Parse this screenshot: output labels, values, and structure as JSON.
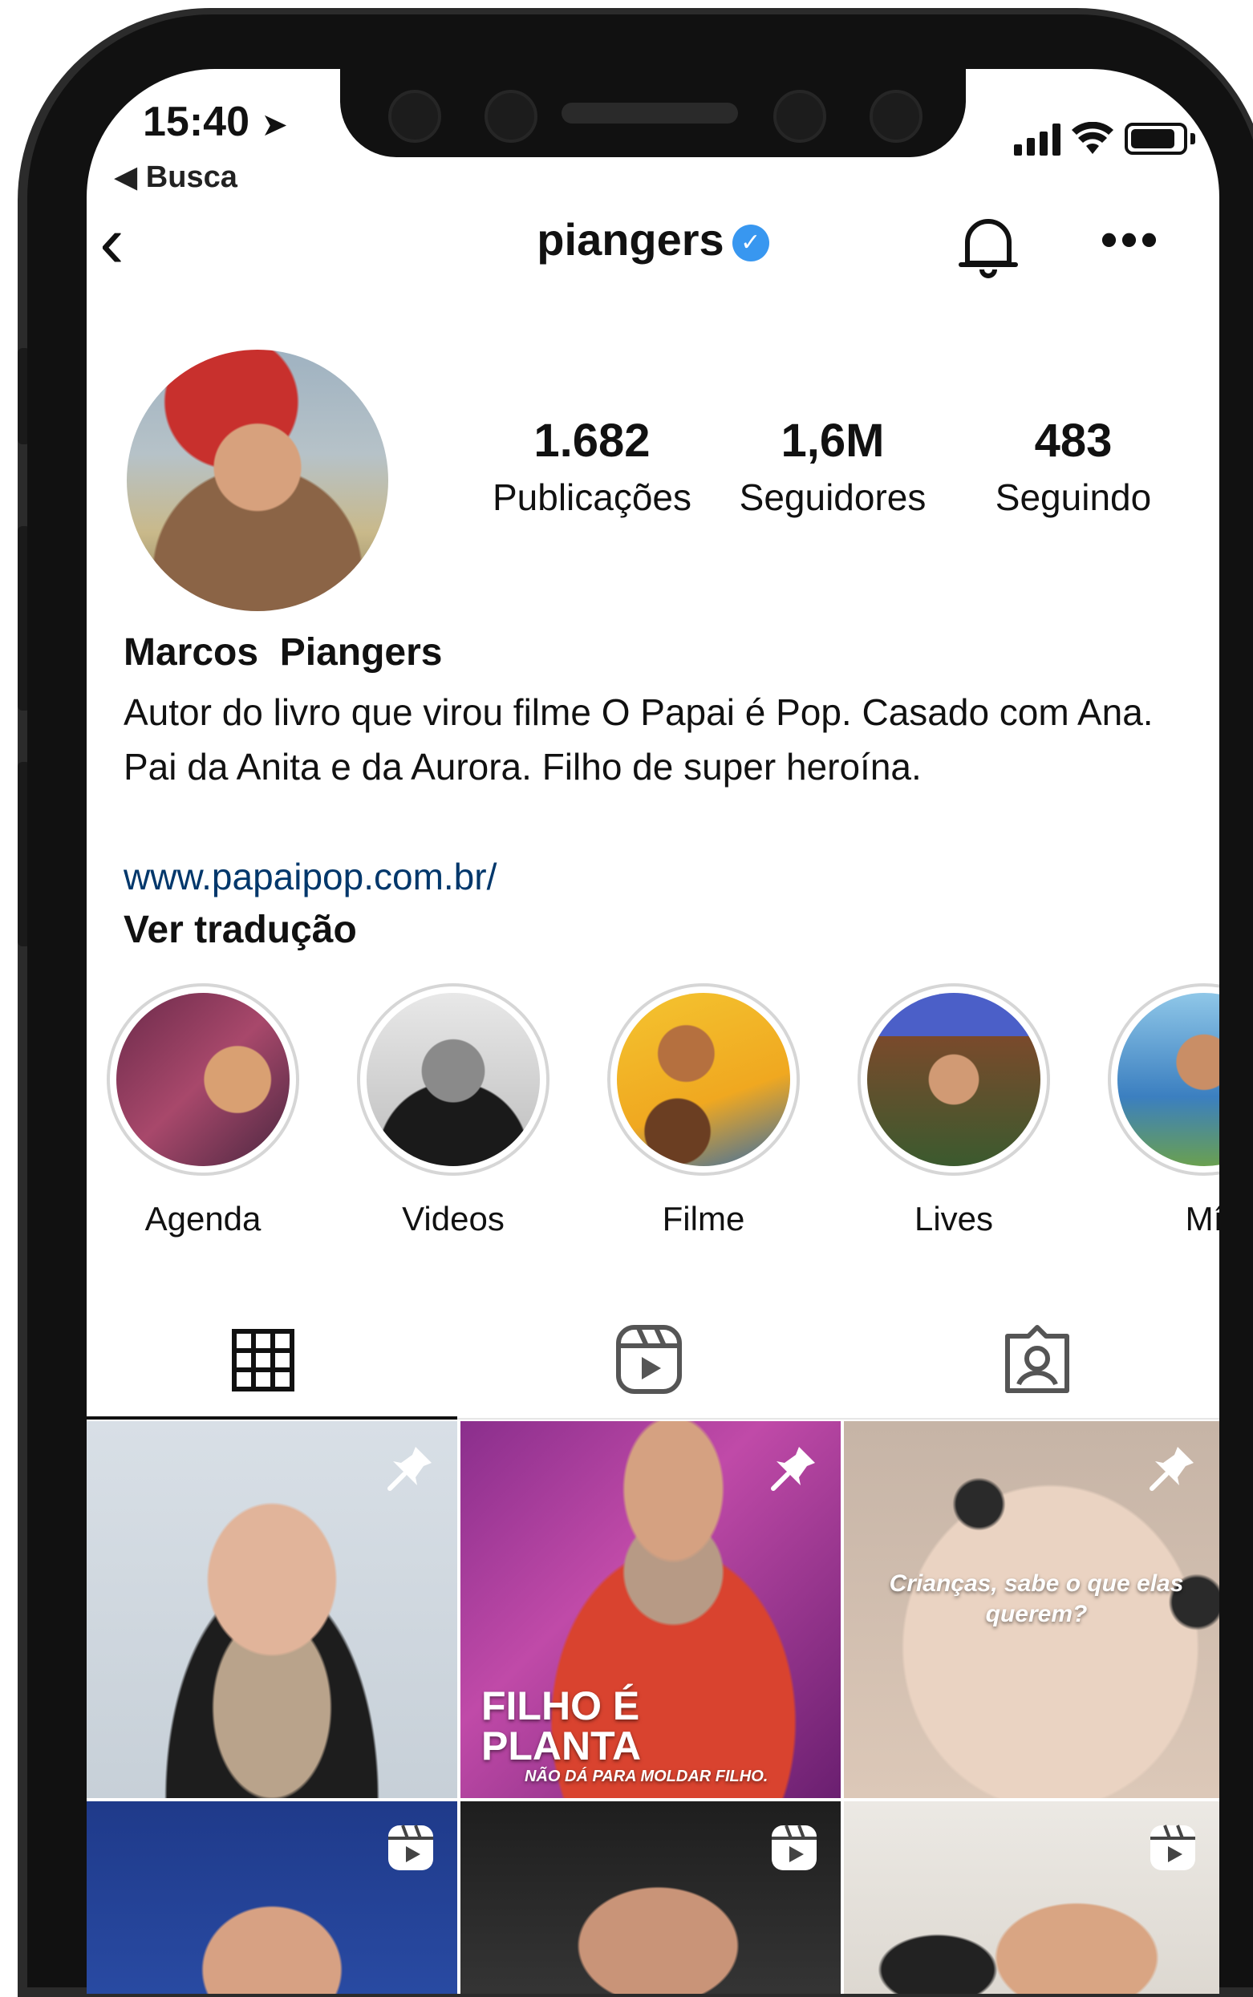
{
  "status_bar": {
    "time": "15:40",
    "back_app": "Busca"
  },
  "header": {
    "username": "piangers"
  },
  "stats": [
    {
      "value": "1.682",
      "label": "Publicações"
    },
    {
      "value": "1,6M",
      "label": "Seguidores"
    },
    {
      "value": "483",
      "label": "Seguindo"
    }
  ],
  "profile": {
    "full_name": "Marcos  Piangers",
    "bio": "Autor do livro que virou filme O Papai é Pop. Casado com Ana. Pai da Anita e da Aurora. Filho de super heroína.",
    "link": "www.papaipop.com.br/",
    "translate": "Ver tradução"
  },
  "highlights": [
    {
      "label": "Agenda"
    },
    {
      "label": "Videos"
    },
    {
      "label": "Filme"
    },
    {
      "label": "Lives"
    },
    {
      "label": "Mí"
    }
  ],
  "posts": {
    "post2_title": "FILHO É PLANTA",
    "post2_subtitle": "NÃO DÁ PARA MOLDAR FILHO.",
    "post3_caption": "Crianças, sabe o que elas querem?"
  },
  "colors": {
    "verified": "#3897f0",
    "link": "#00376b"
  }
}
